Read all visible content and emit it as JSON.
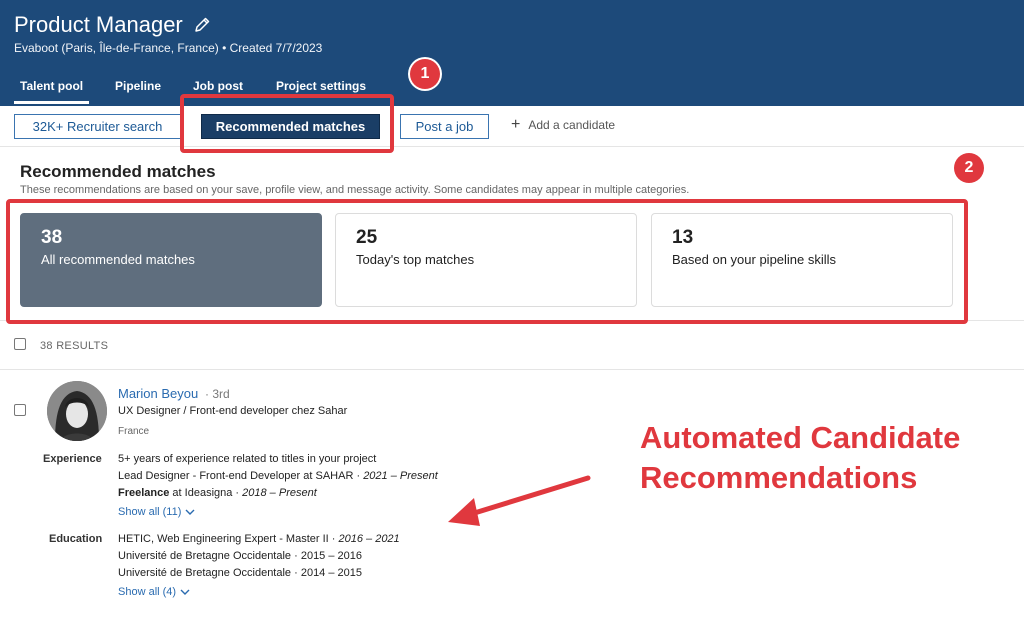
{
  "header": {
    "title": "Product Manager",
    "subtitle": "Evaboot (Paris, Île-de-France, France) • Created 7/7/2023",
    "tabs": [
      {
        "label": "Talent pool"
      },
      {
        "label": "Pipeline"
      },
      {
        "label": "Job post"
      },
      {
        "label": "Project settings"
      }
    ],
    "icons": {
      "edit": "pencil-icon"
    }
  },
  "actions": {
    "recruiter_search": "32K+ Recruiter search",
    "recommended_matches": "Recommended matches",
    "post_job": "Post a job",
    "add_candidate": "Add a candidate",
    "add_icon": "+"
  },
  "section": {
    "title": "Recommended matches",
    "description": "These recommendations are based on your save, profile view, and message activity. Some candidates may appear in multiple categories."
  },
  "cards": [
    {
      "count": "38",
      "label": "All recommended matches"
    },
    {
      "count": "25",
      "label": "Today's top matches"
    },
    {
      "count": "13",
      "label": "Based on your pipeline skills"
    }
  ],
  "results": {
    "count_label": "38 RESULTS"
  },
  "candidate": {
    "name": "Marion Beyou",
    "degree": "· 3rd",
    "headline": "UX Designer / Front-end developer chez Sahar",
    "location": "France",
    "experience_label": "Experience",
    "experience_summary": "5+ years of experience related to titles in your project",
    "experience": [
      {
        "title": "Lead Designer - Front-end Developer at SAHAR",
        "sep": " · ",
        "dates": "2021 – Present"
      },
      {
        "title": "Freelance",
        "company": " at Ideasigna",
        "sep": " · ",
        "dates": "2018 – Present"
      }
    ],
    "experience_show_all": "Show all (11)",
    "education_label": "Education",
    "education": [
      {
        "school": "HETIC, Web Engineering Expert - Master II",
        "sep": " · ",
        "dates": "2016 – 2021"
      },
      {
        "school": "Université de Bretagne Occidentale",
        "sep": " · ",
        "dates": "2015 – 2016"
      },
      {
        "school": "Université de Bretagne Occidentale",
        "sep": " · ",
        "dates": "2014 – 2015"
      }
    ],
    "education_show_all": "Show all (4)"
  },
  "annotations": {
    "badge1": "1",
    "badge2": "2",
    "text_line1": "Automated Candidate",
    "text_line2": "Recommendations",
    "color": "#e0383e"
  },
  "colors": {
    "header_bg": "#1d4a7a",
    "primary_button": "#1a3e66",
    "link": "#2a6bb0",
    "active_card": "#5f6e7e"
  }
}
